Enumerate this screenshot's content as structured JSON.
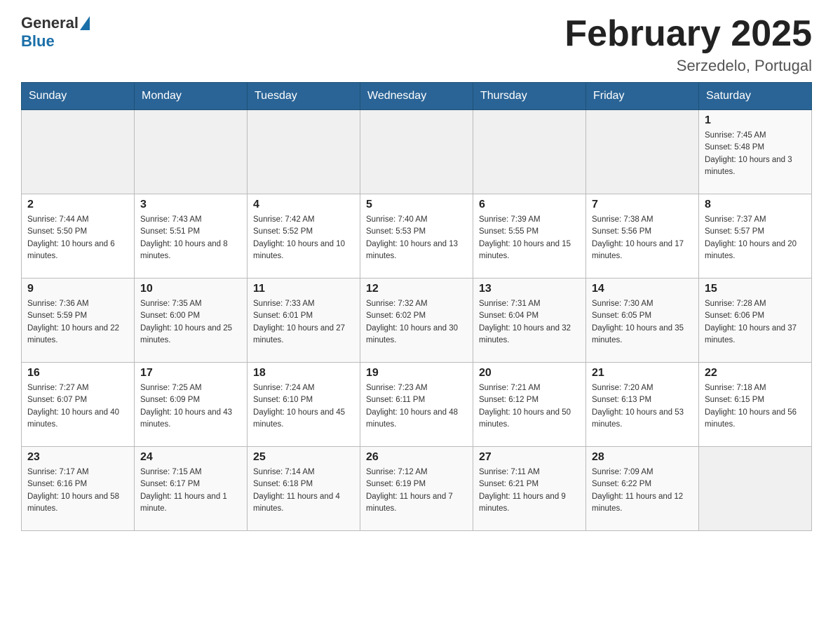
{
  "header": {
    "logo_general": "General",
    "logo_blue": "Blue",
    "title": "February 2025",
    "location": "Serzedelo, Portugal"
  },
  "days_of_week": [
    "Sunday",
    "Monday",
    "Tuesday",
    "Wednesday",
    "Thursday",
    "Friday",
    "Saturday"
  ],
  "weeks": [
    [
      {
        "day": "",
        "info": ""
      },
      {
        "day": "",
        "info": ""
      },
      {
        "day": "",
        "info": ""
      },
      {
        "day": "",
        "info": ""
      },
      {
        "day": "",
        "info": ""
      },
      {
        "day": "",
        "info": ""
      },
      {
        "day": "1",
        "info": "Sunrise: 7:45 AM\nSunset: 5:48 PM\nDaylight: 10 hours and 3 minutes."
      }
    ],
    [
      {
        "day": "2",
        "info": "Sunrise: 7:44 AM\nSunset: 5:50 PM\nDaylight: 10 hours and 6 minutes."
      },
      {
        "day": "3",
        "info": "Sunrise: 7:43 AM\nSunset: 5:51 PM\nDaylight: 10 hours and 8 minutes."
      },
      {
        "day": "4",
        "info": "Sunrise: 7:42 AM\nSunset: 5:52 PM\nDaylight: 10 hours and 10 minutes."
      },
      {
        "day": "5",
        "info": "Sunrise: 7:40 AM\nSunset: 5:53 PM\nDaylight: 10 hours and 13 minutes."
      },
      {
        "day": "6",
        "info": "Sunrise: 7:39 AM\nSunset: 5:55 PM\nDaylight: 10 hours and 15 minutes."
      },
      {
        "day": "7",
        "info": "Sunrise: 7:38 AM\nSunset: 5:56 PM\nDaylight: 10 hours and 17 minutes."
      },
      {
        "day": "8",
        "info": "Sunrise: 7:37 AM\nSunset: 5:57 PM\nDaylight: 10 hours and 20 minutes."
      }
    ],
    [
      {
        "day": "9",
        "info": "Sunrise: 7:36 AM\nSunset: 5:59 PM\nDaylight: 10 hours and 22 minutes."
      },
      {
        "day": "10",
        "info": "Sunrise: 7:35 AM\nSunset: 6:00 PM\nDaylight: 10 hours and 25 minutes."
      },
      {
        "day": "11",
        "info": "Sunrise: 7:33 AM\nSunset: 6:01 PM\nDaylight: 10 hours and 27 minutes."
      },
      {
        "day": "12",
        "info": "Sunrise: 7:32 AM\nSunset: 6:02 PM\nDaylight: 10 hours and 30 minutes."
      },
      {
        "day": "13",
        "info": "Sunrise: 7:31 AM\nSunset: 6:04 PM\nDaylight: 10 hours and 32 minutes."
      },
      {
        "day": "14",
        "info": "Sunrise: 7:30 AM\nSunset: 6:05 PM\nDaylight: 10 hours and 35 minutes."
      },
      {
        "day": "15",
        "info": "Sunrise: 7:28 AM\nSunset: 6:06 PM\nDaylight: 10 hours and 37 minutes."
      }
    ],
    [
      {
        "day": "16",
        "info": "Sunrise: 7:27 AM\nSunset: 6:07 PM\nDaylight: 10 hours and 40 minutes."
      },
      {
        "day": "17",
        "info": "Sunrise: 7:25 AM\nSunset: 6:09 PM\nDaylight: 10 hours and 43 minutes."
      },
      {
        "day": "18",
        "info": "Sunrise: 7:24 AM\nSunset: 6:10 PM\nDaylight: 10 hours and 45 minutes."
      },
      {
        "day": "19",
        "info": "Sunrise: 7:23 AM\nSunset: 6:11 PM\nDaylight: 10 hours and 48 minutes."
      },
      {
        "day": "20",
        "info": "Sunrise: 7:21 AM\nSunset: 6:12 PM\nDaylight: 10 hours and 50 minutes."
      },
      {
        "day": "21",
        "info": "Sunrise: 7:20 AM\nSunset: 6:13 PM\nDaylight: 10 hours and 53 minutes."
      },
      {
        "day": "22",
        "info": "Sunrise: 7:18 AM\nSunset: 6:15 PM\nDaylight: 10 hours and 56 minutes."
      }
    ],
    [
      {
        "day": "23",
        "info": "Sunrise: 7:17 AM\nSunset: 6:16 PM\nDaylight: 10 hours and 58 minutes."
      },
      {
        "day": "24",
        "info": "Sunrise: 7:15 AM\nSunset: 6:17 PM\nDaylight: 11 hours and 1 minute."
      },
      {
        "day": "25",
        "info": "Sunrise: 7:14 AM\nSunset: 6:18 PM\nDaylight: 11 hours and 4 minutes."
      },
      {
        "day": "26",
        "info": "Sunrise: 7:12 AM\nSunset: 6:19 PM\nDaylight: 11 hours and 7 minutes."
      },
      {
        "day": "27",
        "info": "Sunrise: 7:11 AM\nSunset: 6:21 PM\nDaylight: 11 hours and 9 minutes."
      },
      {
        "day": "28",
        "info": "Sunrise: 7:09 AM\nSunset: 6:22 PM\nDaylight: 11 hours and 12 minutes."
      },
      {
        "day": "",
        "info": ""
      }
    ]
  ]
}
